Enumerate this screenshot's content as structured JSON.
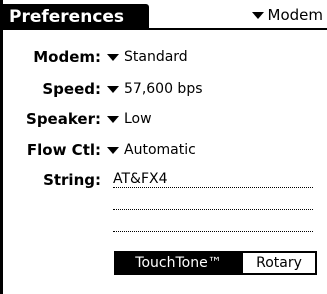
{
  "title": "Preferences",
  "panel_picker": {
    "selected": "Modem"
  },
  "fields": [
    {
      "label": "Modem:",
      "value": "Standard"
    },
    {
      "label": "Speed:",
      "value": "57,600 bps"
    },
    {
      "label": "Speaker:",
      "value": "Low"
    },
    {
      "label": "Flow Ctl:",
      "value": "Automatic"
    }
  ],
  "string_field": {
    "label": "String:",
    "value": "AT&FX4"
  },
  "dial_mode": {
    "options": [
      "TouchTone™",
      "Rotary"
    ],
    "selected": "TouchTone™"
  }
}
